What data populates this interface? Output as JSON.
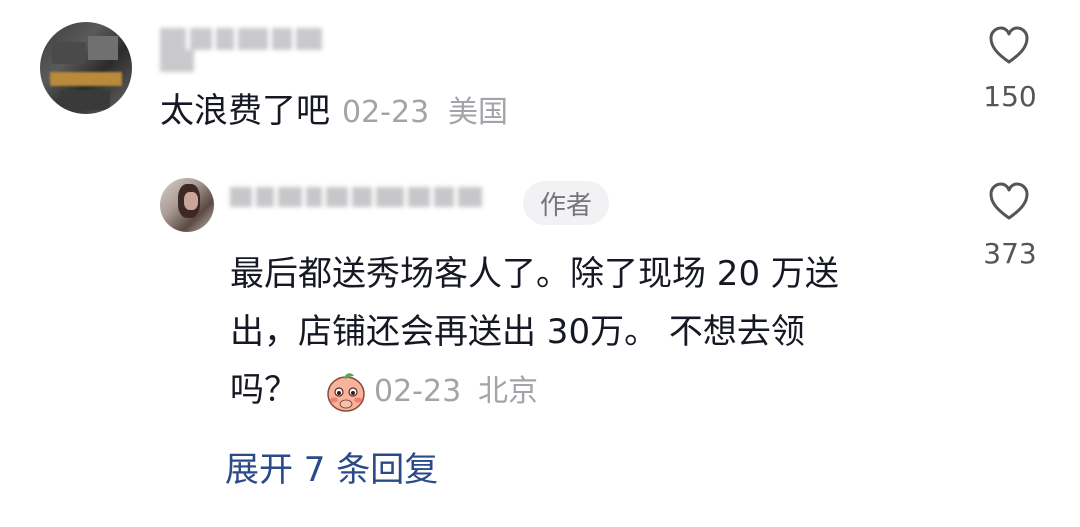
{
  "comment": {
    "author_name": "Sally Hedd",
    "text": "太浪费了吧",
    "date": "02-23",
    "location": "美国",
    "like_count": "150",
    "like_icon": "heart-outline-icon"
  },
  "reply": {
    "author_name": "LLGSTRTRTR",
    "author_badge": "作者",
    "text_line1": "最后都送秀场客人了。除了现场 20 万送",
    "text_line2": "出，店铺还会再送出 30万。 不想去领",
    "text_line3": "吗？",
    "emoji": "shy-face-emoji",
    "date": "02-23",
    "location": "北京",
    "like_count": "373",
    "like_icon": "heart-outline-icon"
  },
  "expand_replies": "展开 7 条回复"
}
